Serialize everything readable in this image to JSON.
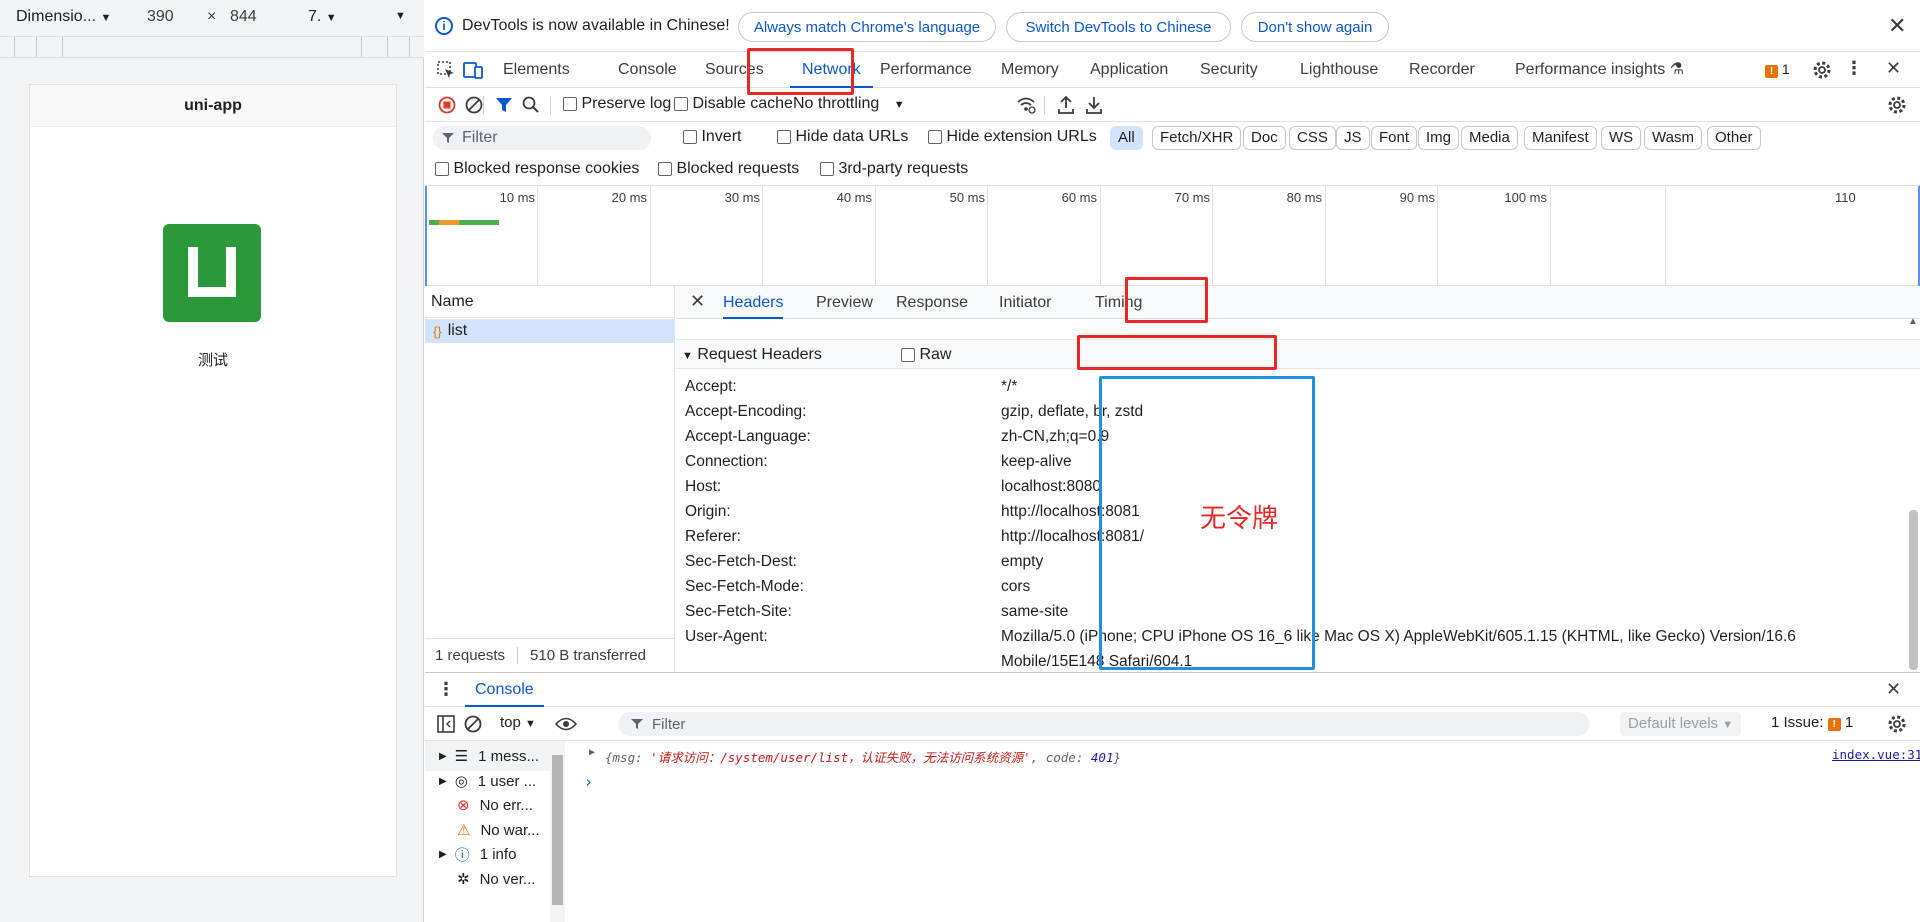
{
  "emulator": {
    "device_select": "Dimensio...",
    "width": "390",
    "times": "×",
    "height": "844",
    "zoom": "7.",
    "nav_title": "uni-app",
    "page_text": "测试"
  },
  "infobar": {
    "message": "DevTools is now available in Chinese!",
    "btn_match": "Always match Chrome's language",
    "btn_switch": "Switch DevTools to Chinese",
    "btn_dismiss": "Don't show again"
  },
  "tabs": [
    "Elements",
    "Console",
    "Sources",
    "Network",
    "Performance",
    "Memory",
    "Application",
    "Security",
    "Lighthouse",
    "Recorder",
    "Performance insights"
  ],
  "issues_count": "1",
  "network_toolbar": {
    "preserve_log": "Preserve log",
    "disable_cache": "Disable cache",
    "throttling": "No throttling"
  },
  "filter": {
    "placeholder": "Filter",
    "invert": "Invert",
    "hide_data_urls": "Hide data URLs",
    "hide_extension_urls": "Hide extension URLs",
    "types": [
      "All",
      "Fetch/XHR",
      "Doc",
      "CSS",
      "JS",
      "Font",
      "Img",
      "Media",
      "Manifest",
      "WS",
      "Wasm",
      "Other"
    ],
    "blocked_cookies": "Blocked response cookies",
    "blocked_requests": "Blocked requests",
    "third_party": "3rd-party requests"
  },
  "timeline_ticks": [
    "10 ms",
    "20 ms",
    "30 ms",
    "40 ms",
    "50 ms",
    "60 ms",
    "70 ms",
    "80 ms",
    "90 ms",
    "100 ms",
    "110"
  ],
  "requests": {
    "name_header": "Name",
    "rows": [
      "list"
    ],
    "status_count": "1 requests",
    "status_transferred": "510 B transferred"
  },
  "detail": {
    "tabs": [
      "Headers",
      "Preview",
      "Response",
      "Initiator",
      "Timing"
    ],
    "section_title": "Request Headers",
    "raw_label": "Raw",
    "headers": [
      {
        "name": "Accept:",
        "value": "*/*"
      },
      {
        "name": "Accept-Encoding:",
        "value": "gzip, deflate, br, zstd"
      },
      {
        "name": "Accept-Language:",
        "value": "zh-CN,zh;q=0.9"
      },
      {
        "name": "Connection:",
        "value": "keep-alive"
      },
      {
        "name": "Host:",
        "value": "localhost:8080"
      },
      {
        "name": "Origin:",
        "value": "http://localhost:8081"
      },
      {
        "name": "Referer:",
        "value": "http://localhost:8081/"
      },
      {
        "name": "Sec-Fetch-Dest:",
        "value": "empty"
      },
      {
        "name": "Sec-Fetch-Mode:",
        "value": "cors"
      },
      {
        "name": "Sec-Fetch-Site:",
        "value": "same-site"
      },
      {
        "name": "User-Agent:",
        "value": "Mozilla/5.0 (iPhone; CPU iPhone OS 16_6 like Mac OS X) AppleWebKit/605.1.15 (KHTML, like Gecko) Version/16.6",
        "value2": "Mobile/15E148 Safari/604.1"
      }
    ],
    "annotation": "无令牌"
  },
  "console": {
    "tab": "Console",
    "context": "top",
    "filter_placeholder": "Filter",
    "levels": "Default levels",
    "issues": "1 Issue:",
    "issues_count": "1",
    "sidebar": [
      "1 mess...",
      "1 user ...",
      "No err...",
      "No war...",
      "1 info",
      "No ver..."
    ],
    "message_key_msg": "msg",
    "message_text": "'请求访问：/system/user/list，认证失败，无法访问系统资源'",
    "message_key_code": "code",
    "message_code": "401",
    "source_link": "index.vue:31"
  },
  "colors": {
    "accent": "#0b57d0",
    "annotation_red": "#e82727",
    "annotation_blue": "#1e90e6",
    "logo_green": "#2b9939"
  }
}
